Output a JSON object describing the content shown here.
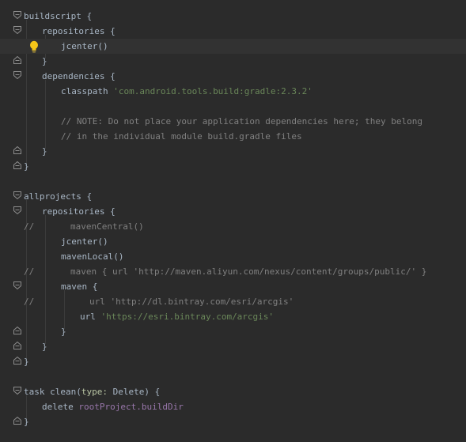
{
  "lines": [
    [
      {
        "t": "buildscript {",
        "c": "plain"
      }
    ],
    [
      {
        "t": "repositories {",
        "c": "plain"
      }
    ],
    [
      {
        "t": "jcenter",
        "c": "plain"
      },
      {
        "t": "()",
        "c": "plain"
      }
    ],
    [
      {
        "t": "}",
        "c": "plain"
      }
    ],
    [
      {
        "t": "dependencies {",
        "c": "plain"
      }
    ],
    [
      {
        "t": "classpath ",
        "c": "plain"
      },
      {
        "t": "'com.android.tools.build:gradle:2.3.2'",
        "c": "str"
      }
    ],
    [],
    [
      {
        "t": "// NOTE: Do not place your application dependencies here; they belong",
        "c": "comment"
      }
    ],
    [
      {
        "t": "// in the individual module build.gradle files",
        "c": "comment"
      }
    ],
    [
      {
        "t": "}",
        "c": "plain"
      }
    ],
    [
      {
        "t": "}",
        "c": "plain"
      }
    ],
    [],
    [
      {
        "t": "allprojects {",
        "c": "plain"
      }
    ],
    [
      {
        "t": "repositories {",
        "c": "plain"
      }
    ],
    [
      {
        "t": "//",
        "c": "comment"
      },
      {
        "t": "mavenCentral()",
        "c": "commented"
      }
    ],
    [
      {
        "t": "jcenter()",
        "c": "plain"
      }
    ],
    [
      {
        "t": "mavenLocal()",
        "c": "plain"
      }
    ],
    [
      {
        "t": "//",
        "c": "comment"
      },
      {
        "t": "maven { url 'http://maven.aliyun.com/nexus/content/groups/public/' }",
        "c": "commented"
      }
    ],
    [
      {
        "t": "maven {",
        "c": "plain"
      }
    ],
    [
      {
        "t": "//",
        "c": "comment"
      },
      {
        "t": "url 'http://dl.bintray.com/esri/arcgis'",
        "c": "commented"
      }
    ],
    [
      {
        "t": "url ",
        "c": "plain"
      },
      {
        "t": "'https://esri.bintray.com/arcgis'",
        "c": "str"
      }
    ],
    [
      {
        "t": "}",
        "c": "plain"
      }
    ],
    [
      {
        "t": "}",
        "c": "plain"
      }
    ],
    [
      {
        "t": "}",
        "c": "plain"
      }
    ],
    [],
    [
      {
        "t": "task ",
        "c": "plain"
      },
      {
        "t": "clean",
        "c": "plain"
      },
      {
        "t": "(",
        "c": "plain"
      },
      {
        "t": "type:",
        "c": "named"
      },
      {
        "t": " Delete) {",
        "c": "plain"
      }
    ],
    [
      {
        "t": "delete ",
        "c": "plain"
      },
      {
        "t": "rootProject.buildDir",
        "c": "prop"
      }
    ],
    [
      {
        "t": "}",
        "c": "plain"
      }
    ]
  ],
  "icons": {
    "fold_marker": "fold-marker-icon",
    "intention_bulb": "lightbulb-icon"
  },
  "colors": {
    "background": "#2b2b2b",
    "current_line": "#323232",
    "plain": "#a9b7c6",
    "string": "#6a8759",
    "comment": "#808080",
    "bulb": "#f5c518"
  }
}
